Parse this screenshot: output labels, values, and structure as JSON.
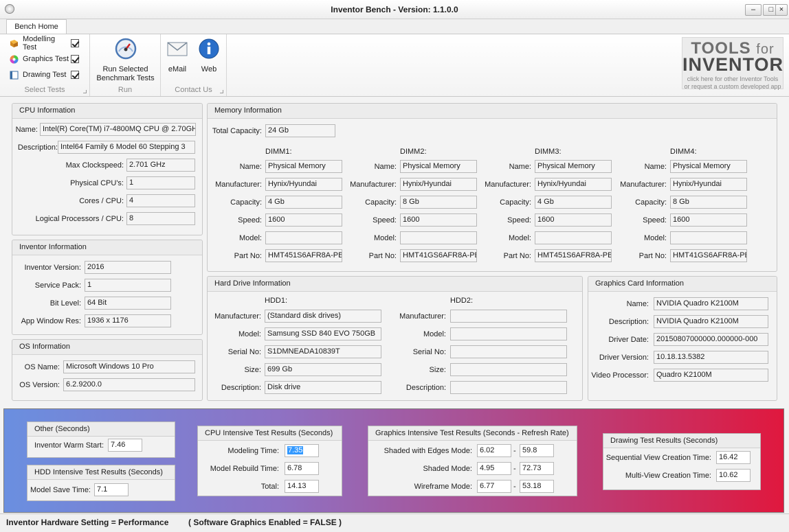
{
  "window": {
    "title": "Inventor Bench  -  Version: 1.1.0.0",
    "min": "–",
    "max": "□",
    "close": "×"
  },
  "ribbon": {
    "tab": "Bench Home",
    "select_tests": {
      "items": [
        {
          "label": "Modelling Test"
        },
        {
          "label": "Graphics Test"
        },
        {
          "label": "Drawing Test"
        }
      ],
      "group_label": "Select Tests"
    },
    "run": {
      "button_line1": "Run Selected",
      "button_line2": "Benchmark Tests",
      "group_label": "Run"
    },
    "contact": {
      "email": "eMail",
      "web": "Web",
      "group_label": "Contact Us"
    },
    "logo": {
      "line1a": "TOOLS",
      "line1b": "for",
      "line2": "INVENTOR",
      "line3": "click here for other Inventor Tools",
      "line4": "or request a custom developed app"
    }
  },
  "cpu": {
    "title": "CPU Information",
    "name_label": "Name:",
    "name": "Intel(R) Core(TM) i7-4800MQ CPU @ 2.70GHz",
    "desc_label": "Description:",
    "desc": "Intel64 Family 6 Model 60 Stepping 3",
    "clock_label": "Max Clockspeed:",
    "clock": "2.701 GHz",
    "phys_label": "Physical CPU's:",
    "phys": "1",
    "cores_label": "Cores / CPU:",
    "cores": "4",
    "logical_label": "Logical Processors / CPU:",
    "logical": "8"
  },
  "inventor": {
    "title": "Inventor Information",
    "version_label": "Inventor Version:",
    "version": "2016",
    "sp_label": "Service Pack:",
    "sp": "1",
    "bit_label": "Bit Level:",
    "bit": "64 Bit",
    "res_label": "App Window Res:",
    "res": "1936 x 1176"
  },
  "os": {
    "title": "OS Information",
    "name_label": "OS Name:",
    "name": "Microsoft Windows 10 Pro",
    "version_label": "OS Version:",
    "version": "6.2.9200.0"
  },
  "memory": {
    "title": "Memory Information",
    "total_label": "Total Capacity:",
    "total": "24 Gb",
    "labels": {
      "name": "Name:",
      "manufacturer": "Manufacturer:",
      "capacity": "Capacity:",
      "speed": "Speed:",
      "model": "Model:",
      "part": "Part No:"
    },
    "dimms": [
      {
        "title": "DIMM1:",
        "name": "Physical Memory",
        "manufacturer": "Hynix/Hyundai",
        "capacity": "4 Gb",
        "speed": "1600",
        "model": "",
        "part": "HMT451S6AFR8A-PB"
      },
      {
        "title": "DIMM2:",
        "name": "Physical Memory",
        "manufacturer": "Hynix/Hyundai",
        "capacity": "8 Gb",
        "speed": "1600",
        "model": "",
        "part": "HMT41GS6AFR8A-PB"
      },
      {
        "title": "DIMM3:",
        "name": "Physical Memory",
        "manufacturer": "Hynix/Hyundai",
        "capacity": "4 Gb",
        "speed": "1600",
        "model": "",
        "part": "HMT451S6AFR8A-PB"
      },
      {
        "title": "DIMM4:",
        "name": "Physical Memory",
        "manufacturer": "Hynix/Hyundai",
        "capacity": "8 Gb",
        "speed": "1600",
        "model": "",
        "part": "HMT41GS6AFR8A-PB"
      }
    ]
  },
  "hdd": {
    "title": "Hard Drive Information",
    "labels": {
      "manufacturer": "Manufacturer:",
      "model": "Model:",
      "serial": "Serial No:",
      "size": "Size:",
      "description": "Description:"
    },
    "drives": [
      {
        "title": "HDD1:",
        "manufacturer": "(Standard disk drives)",
        "model": "Samsung SSD 840 EVO 750GB",
        "serial": "S1DMNEADA10839T",
        "size": "699 Gb",
        "description": "Disk drive"
      },
      {
        "title": "HDD2:",
        "manufacturer": "",
        "model": "",
        "serial": "",
        "size": "",
        "description": ""
      }
    ]
  },
  "gpu": {
    "title": "Graphics Card Information",
    "name_label": "Name:",
    "name": "NVIDIA Quadro K2100M",
    "desc_label": "Description:",
    "desc": "NVIDIA Quadro K2100M",
    "date_label": "Driver Date:",
    "date": "20150807000000.000000-000",
    "ver_label": "Driver Version:",
    "ver": "10.18.13.5382",
    "proc_label": "Video Processor:",
    "proc": "Quadro K2100M"
  },
  "results": {
    "other": {
      "title": "Other (Seconds)",
      "warm_label": "Inventor Warm Start:",
      "warm": "7.46"
    },
    "hdd": {
      "title": "HDD Intensive Test Results (Seconds)",
      "save_label": "Model Save Time:",
      "save": "7.1"
    },
    "cpu": {
      "title": "CPU Intensive Test Results (Seconds)",
      "model_label": "Modeling Time:",
      "model": "7.35",
      "rebuild_label": "Model Rebuild Time:",
      "rebuild": "6.78",
      "total_label": "Total:",
      "total": "14.13"
    },
    "graphics": {
      "title": "Graphics Intensive Test Results (Seconds - Refresh Rate)",
      "rows": [
        {
          "label": "Shaded with Edges Mode:",
          "time": "6.02",
          "sep": "-",
          "rate": "59.8"
        },
        {
          "label": "Shaded Mode:",
          "time": "4.95",
          "sep": "-",
          "rate": "72.73"
        },
        {
          "label": "Wireframe Mode:",
          "time": "6.77",
          "sep": "-",
          "rate": "53.18"
        }
      ]
    },
    "drawing": {
      "title": "Drawing Test Results (Seconds)",
      "seq_label": "Sequential View Creation Time:",
      "seq": "16.42",
      "multi_label": "Multi-View Creation Time:",
      "multi": "10.62"
    }
  },
  "status": {
    "setting": "Inventor Hardware Setting  =  Performance",
    "graphics": "( Software Graphics Enabled  =  FALSE )"
  }
}
